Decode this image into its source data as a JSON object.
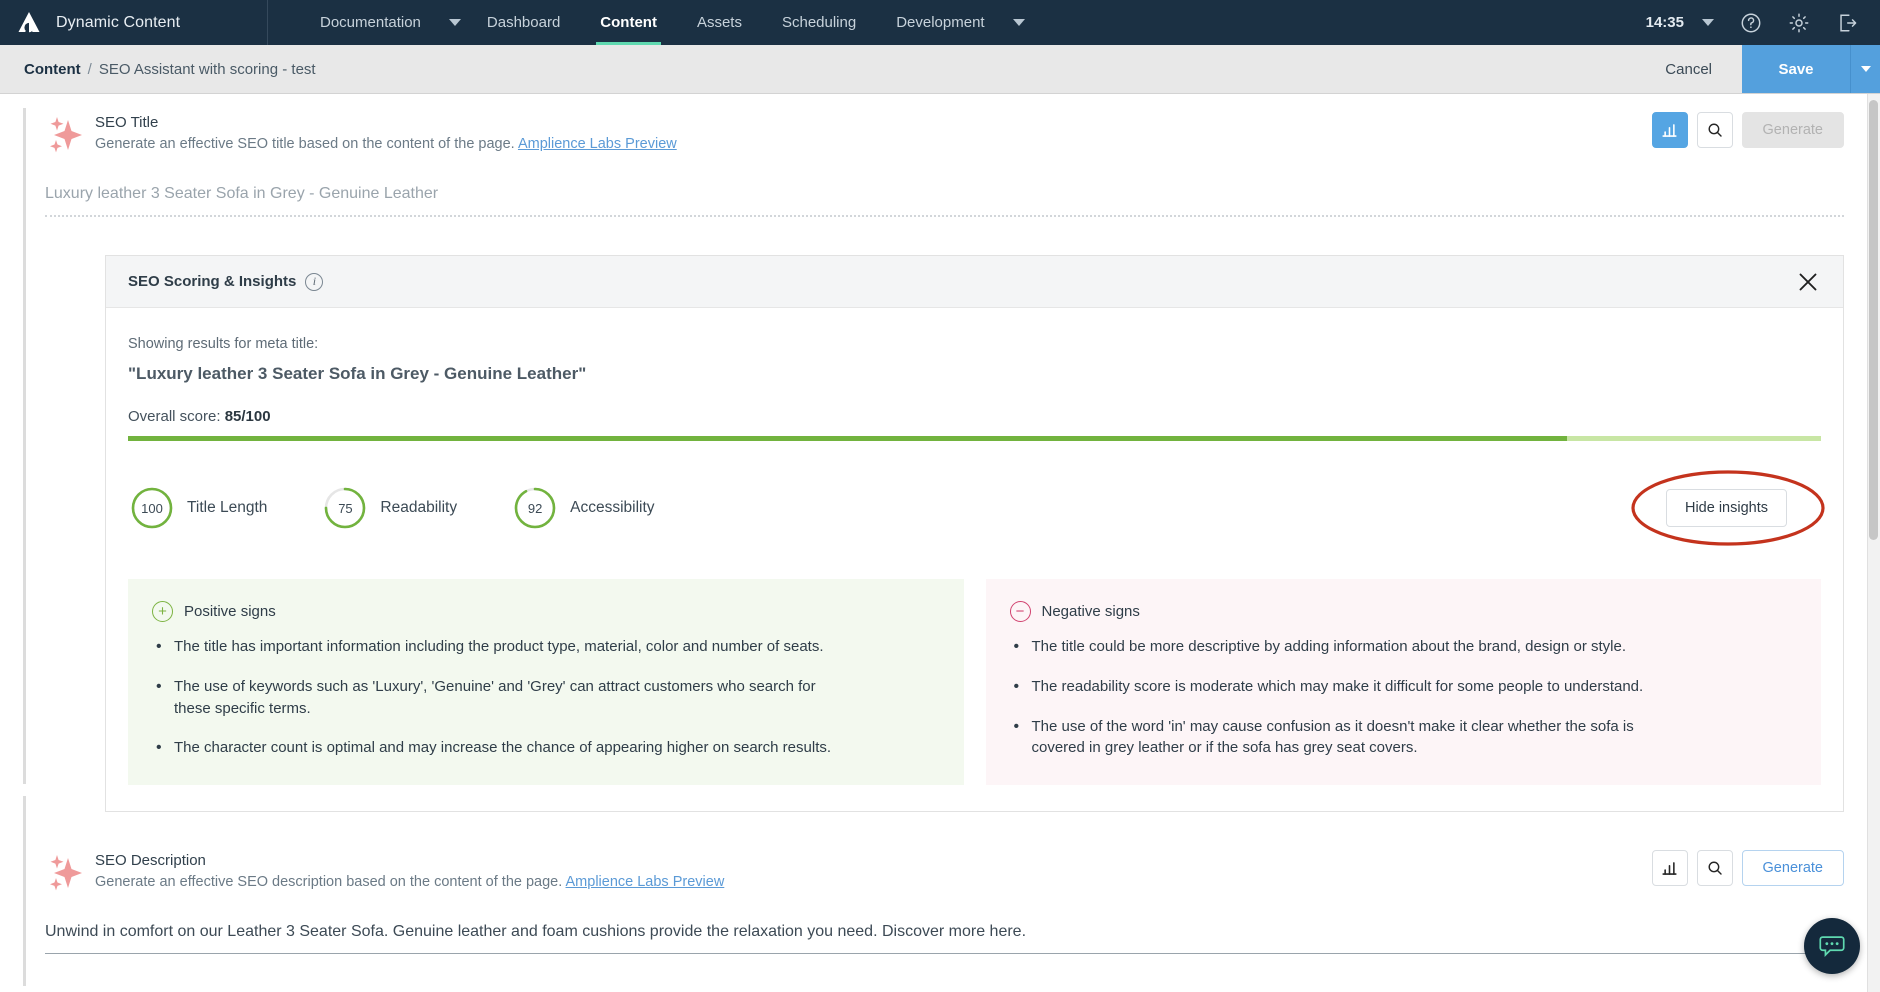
{
  "topbar": {
    "logo_icon": "amplience-logo-icon",
    "brand": "Dynamic Content",
    "nav": [
      {
        "label": "Documentation",
        "has_caret": true,
        "active": false
      },
      {
        "label": "Dashboard",
        "has_caret": false,
        "active": false
      },
      {
        "label": "Content",
        "has_caret": false,
        "active": true
      },
      {
        "label": "Assets",
        "has_caret": false,
        "active": false
      },
      {
        "label": "Scheduling",
        "has_caret": false,
        "active": false
      },
      {
        "label": "Development",
        "has_caret": true,
        "active": false
      }
    ],
    "clock": "14:35",
    "icons": [
      "chevron-down-icon",
      "help-circle-icon",
      "gear-icon",
      "logout-icon"
    ],
    "background": "#1b3043",
    "active_underline": "#5fd9b0"
  },
  "breadcrumb": {
    "root": "Content",
    "separator": "/",
    "leaf": "SEO Assistant with scoring - test",
    "cancel_label": "Cancel",
    "save_label": "Save",
    "save_color": "#54a0dd"
  },
  "fields": [
    {
      "title": "SEO Title",
      "description": "Generate an effective SEO title based on the content of the page.",
      "link": "Amplience Labs Preview",
      "value": "Luxury leather 3 Seater Sofa in Grey - Genuine Leather",
      "chart_button_active": true,
      "generate_label": "Generate",
      "generate_enabled": false
    },
    {
      "title": "SEO Description",
      "description": "Generate an effective SEO description based on the content of the page.",
      "link": "Amplience Labs Preview",
      "value": "Unwind in comfort on our Leather 3 Seater Sofa. Genuine leather and foam cushions provide the relaxation you need. Discover more here.",
      "chart_button_active": false,
      "generate_label": "Generate",
      "generate_enabled": true
    }
  ],
  "scoring_panel": {
    "title": "SEO Scoring & Insights",
    "info_icon": "info-circle-icon",
    "close_icon": "close-icon",
    "showing_label": "Showing results for meta title:",
    "meta_title": "\"Luxury leather 3 Seater Sofa in Grey - Genuine Leather\"",
    "overall_label": "Overall score:",
    "overall_value": "85/100",
    "overall_percent": 85,
    "progress_fill_color": "#72b33e",
    "progress_track_color": "#c8e6a4",
    "hide_insights_label": "Hide insights",
    "annotation": "red-ellipse-highlight",
    "annotation_color": "#c4331d",
    "scores": [
      {
        "value": "100",
        "percent": 100,
        "label": "Title Length",
        "color": "#72b33e"
      },
      {
        "value": "75",
        "percent": 75,
        "label": "Readability",
        "color": "#72b33e"
      },
      {
        "value": "92",
        "percent": 92,
        "label": "Accessibility",
        "color": "#72b33e"
      }
    ],
    "positive": {
      "title": "Positive signs",
      "icon": "plus-circle-icon",
      "color": "#7cb342",
      "items": [
        "The title has important information including the product type, material, color and number of seats.",
        "The use of keywords such as 'Luxury', 'Genuine' and 'Grey' can attract customers who search for these specific terms.",
        "The character count is optimal and may increase the chance of appearing higher on search results."
      ]
    },
    "negative": {
      "title": "Negative signs",
      "icon": "minus-circle-icon",
      "color": "#d1426f",
      "items": [
        "The title could be more descriptive by adding information about the brand, design or style.",
        "The readability score is moderate which may make it difficult for some people to understand.",
        "The use of the word 'in' may cause confusion as it doesn't make it clear whether the sofa is covered in grey leather or if the sofa has grey seat covers."
      ]
    }
  },
  "chat": {
    "icon": "chat-bubble-icon",
    "background": "#14293c",
    "glyph_color": "#5fd9b0"
  }
}
